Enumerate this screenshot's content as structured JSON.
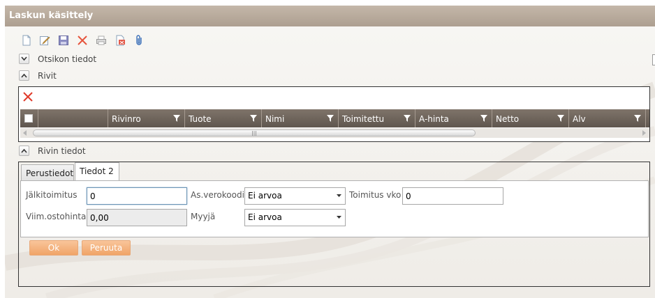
{
  "window": {
    "title": "Laskun käsittely"
  },
  "toolbar": {
    "icons": [
      "new-document-icon",
      "edit-icon",
      "save-icon",
      "delete-icon",
      "print-icon",
      "pdf-icon",
      "attachment-icon"
    ]
  },
  "sections": {
    "header_info": "Otsikon tiedot",
    "rows": "Rivit",
    "row_details": "Rivin tiedot"
  },
  "grid": {
    "columns": [
      "Rivinro",
      "Tuote",
      "Nimi",
      "Toimitettu",
      "A-hinta",
      "Netto",
      "Alv"
    ],
    "rows": [],
    "header_color": "#6e655c"
  },
  "tabs": [
    {
      "label": "Perustiedot",
      "active": false
    },
    {
      "label": "Tiedot 2",
      "active": true
    }
  ],
  "form": {
    "jalkitoimitus": {
      "label": "Jälkitoimitus",
      "value": "0"
    },
    "as_verokoodi": {
      "label": "As.verokoodi",
      "value": "Ei arvoa"
    },
    "toimitus_vko": {
      "label": "Toimitus vko",
      "value": "0"
    },
    "viim_ostohinta": {
      "label": "Viim.ostohinta",
      "value": "0,00"
    },
    "myyja": {
      "label": "Myyjä",
      "value": "Ei arvoa"
    }
  },
  "buttons": {
    "ok": "Ok",
    "cancel": "Peruuta"
  },
  "colors": {
    "title_bar": "#b8ab9c",
    "button": "#f4b07b",
    "delete_red": "#e03a2a"
  }
}
